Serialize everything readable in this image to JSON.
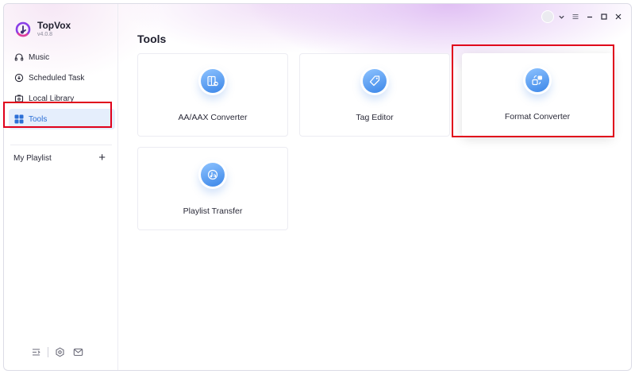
{
  "app": {
    "name": "TopVox",
    "version": "v4.0.8"
  },
  "sidebar": {
    "items": [
      {
        "label": "Music",
        "icon": "headphones-icon"
      },
      {
        "label": "Scheduled Task",
        "icon": "clock-download-icon"
      },
      {
        "label": "Local Library",
        "icon": "folder-icon"
      },
      {
        "label": "Tools",
        "icon": "grid-icon",
        "active": true
      }
    ],
    "playlist_label": "My Playlist",
    "add_symbol": "+"
  },
  "main": {
    "title": "Tools",
    "cards": [
      {
        "label": "AA/AAX Converter",
        "icon": "book-convert-icon"
      },
      {
        "label": "Tag Editor",
        "icon": "tag-icon"
      },
      {
        "label": "Format Converter",
        "icon": "format-convert-icon",
        "highlighted": true
      },
      {
        "label": "Playlist Transfer",
        "icon": "music-transfer-icon"
      }
    ]
  },
  "colors": {
    "accent": "#2b6fd6",
    "highlight_box": "#e0001b",
    "icon_gradient_top": "#8ec3ff",
    "icon_gradient_bottom": "#3b86e8"
  }
}
